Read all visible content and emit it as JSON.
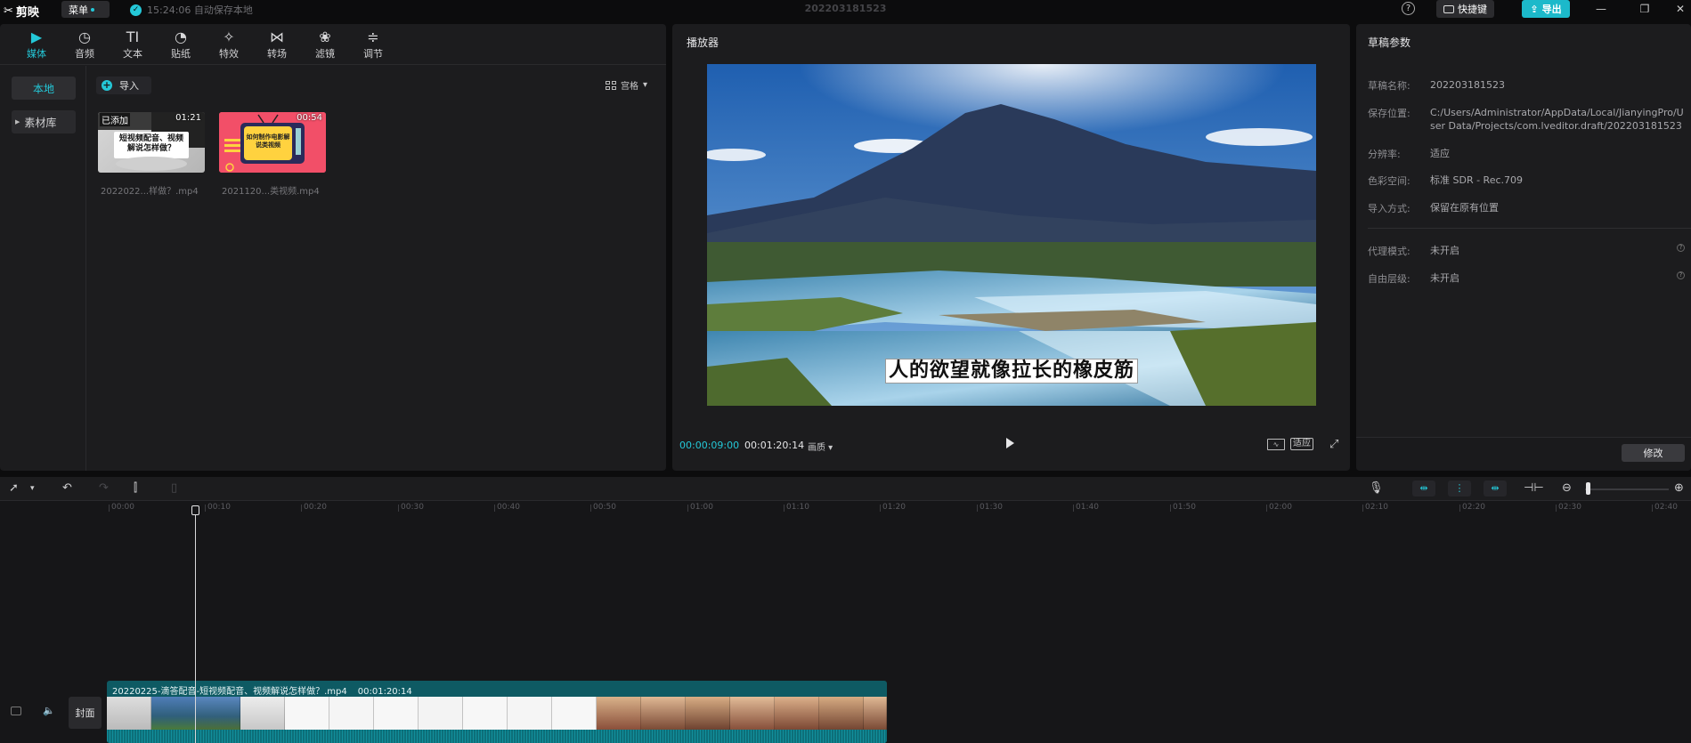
{
  "app": {
    "logo_text": "剪映",
    "menu_label": "菜单",
    "autosave_text": "15:24:06 自动保存本地",
    "project_title": "202203181523",
    "shortcut_label": "快捷键",
    "export_label": "导出"
  },
  "media": {
    "tabs": [
      {
        "label": "媒体",
        "icon": "▶"
      },
      {
        "label": "音频",
        "icon": "◷"
      },
      {
        "label": "文本",
        "icon": "TI"
      },
      {
        "label": "贴纸",
        "icon": "◔"
      },
      {
        "label": "特效",
        "icon": "✧"
      },
      {
        "label": "转场",
        "icon": "⋈"
      },
      {
        "label": "滤镜",
        "icon": "❀"
      },
      {
        "label": "调节",
        "icon": "≑"
      }
    ],
    "nav_local": "本地",
    "nav_library": "素材库",
    "import_label": "导入",
    "view_label": "宫格",
    "items": [
      {
        "name": "2022022...样做？.mp4",
        "duration": "01:21",
        "added": "已添加",
        "thumb_text": "短视频配音、视频解说怎样做？"
      },
      {
        "name": "2021120...类视频.mp4",
        "duration": "00:54",
        "thumb_text": "如何制作电影解说类视频"
      }
    ]
  },
  "player": {
    "title": "播放器",
    "subtitle": "人的欲望就像拉长的橡皮筋",
    "current_time": "00:00:09:00",
    "total_time": "00:01:20:14",
    "quality_label": "画质",
    "ratio_label": "适应"
  },
  "draft": {
    "title": "草稿参数",
    "fields": [
      {
        "label": "草稿名称:",
        "value": "202203181523"
      },
      {
        "label": "保存位置:",
        "value": "C:/Users/Administrator/AppData/Local/JianyingPro/User Data/Projects/com.lveditor.draft/202203181523"
      },
      {
        "label": "分辨率:",
        "value": "适应"
      },
      {
        "label": "色彩空间:",
        "value": "标准 SDR - Rec.709"
      },
      {
        "label": "导入方式:",
        "value": "保留在原有位置"
      },
      {
        "label": "代理模式:",
        "value": "未开启"
      },
      {
        "label": "自由层级:",
        "value": "未开启"
      }
    ],
    "edit_label": "修改"
  },
  "timeline": {
    "ticks": [
      "00:00",
      "00:10",
      "00:20",
      "00:30",
      "00:40",
      "00:50",
      "01:00",
      "01:10",
      "01:20",
      "01:30",
      "01:40",
      "01:50",
      "02:00",
      "02:10",
      "02:20",
      "02:30",
      "02:40"
    ],
    "cover_label": "封面",
    "clip_name": "20220225-滴答配音-短视频配音、视频解说怎样做？.mp4",
    "clip_duration": "00:01:20:14"
  },
  "colors": {
    "accent": "#24c8d8",
    "clip_bg": "#0e5a63",
    "panel_bg": "#1c1c1e"
  }
}
